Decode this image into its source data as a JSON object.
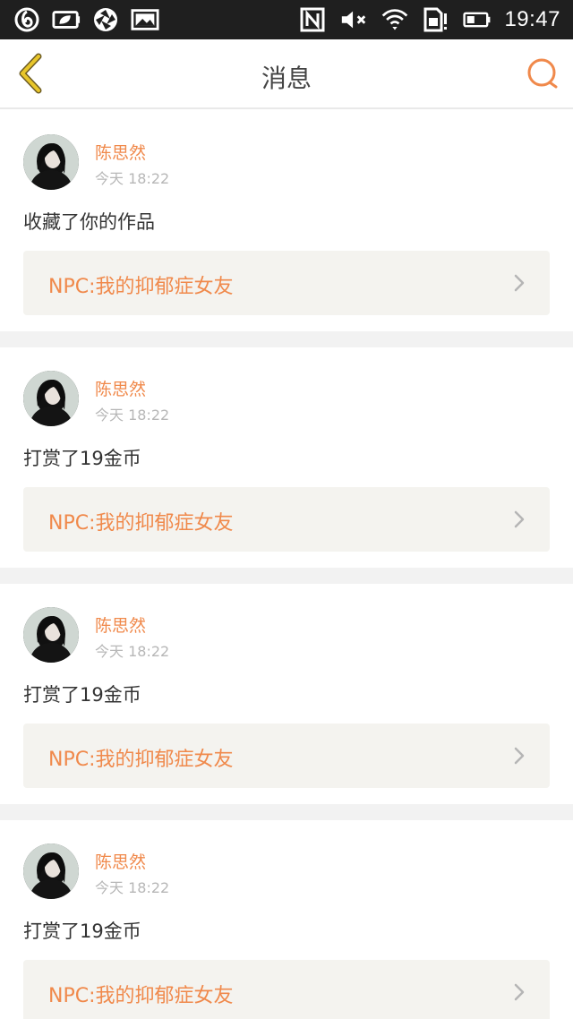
{
  "status_bar": {
    "time": "19:47",
    "left_icons": [
      "netease-icon",
      "leaf-battery-icon",
      "aperture-icon",
      "image-icon"
    ],
    "right_icons": [
      "nfc-icon",
      "mute-icon",
      "wifi-icon",
      "sim-alert-icon",
      "battery-icon"
    ]
  },
  "header": {
    "title": "消息",
    "back_icon": "chevron-left-icon",
    "search_icon": "search-icon"
  },
  "colors": {
    "accent": "#f0894b",
    "back_icon": "#e8c62b",
    "card_bg": "#f4f3ef",
    "separator": "#f2f2f2"
  },
  "messages": [
    {
      "user": "陈思然",
      "time": "今天 18:22",
      "action": "收藏了你的作品",
      "work": "NPC:我的抑郁症女友"
    },
    {
      "user": "陈思然",
      "time": "今天 18:22",
      "action": "打赏了19金币",
      "work": "NPC:我的抑郁症女友"
    },
    {
      "user": "陈思然",
      "time": "今天 18:22",
      "action": "打赏了19金币",
      "work": "NPC:我的抑郁症女友"
    },
    {
      "user": "陈思然",
      "time": "今天 18:22",
      "action": "打赏了19金币",
      "work": "NPC:我的抑郁症女友"
    }
  ]
}
